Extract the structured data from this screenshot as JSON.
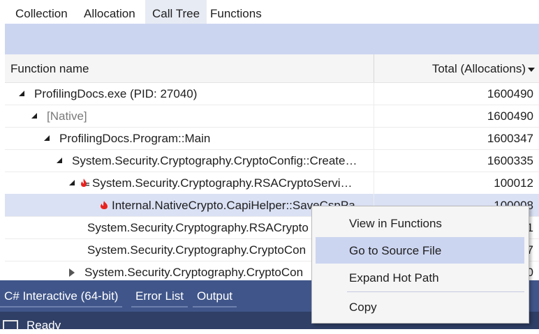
{
  "tabs": [
    "Collection",
    "Allocation",
    "Call Tree",
    "Functions"
  ],
  "active_tab": "Call Tree",
  "columns": {
    "name": "Function name",
    "total": "Total (Allocations)"
  },
  "rows": [
    {
      "label": "ProfilingDocs.exe (PID: 27040)",
      "value": "1600490",
      "expander": "expanded",
      "muted": false,
      "hot": false
    },
    {
      "label": "[Native]",
      "value": "1600490",
      "expander": "expanded",
      "muted": true,
      "hot": false
    },
    {
      "label": "ProfilingDocs.Program::Main",
      "value": "1600347",
      "expander": "expanded",
      "muted": false,
      "hot": false
    },
    {
      "label": "System.Security.Cryptography.CryptoConfig::Create…",
      "value": "1600335",
      "expander": "expanded",
      "muted": false,
      "hot": false
    },
    {
      "label": "System.Security.Cryptography.RSACryptoServi…",
      "value": "100012",
      "expander": "expanded",
      "muted": false,
      "hot": "flame-expand"
    },
    {
      "label": "Internal.NativeCrypto.CapiHelper::SaveCspPa…",
      "value": "100008",
      "expander": "none",
      "muted": false,
      "hot": "flame",
      "selected": true
    },
    {
      "label": "System.Security.Cryptography.RSACrypto",
      "value": "1",
      "expander": "none",
      "muted": false,
      "hot": false
    },
    {
      "label": "System.Security.Cryptography.CryptoCon",
      "value": "7",
      "expander": "none",
      "muted": false,
      "hot": false
    },
    {
      "label": "System.Security.Cryptography.CryptoCon",
      "value": "0",
      "expander": "collapsed",
      "muted": false,
      "hot": false
    }
  ],
  "bottom_tabs": [
    "C# Interactive (64-bit)",
    "Error List",
    "Output"
  ],
  "status": {
    "text": "Ready"
  },
  "context_menu": {
    "items": [
      "View in Functions",
      "Go to Source File",
      "Expand Hot Path",
      "Copy"
    ],
    "highlighted": "Go to Source File"
  },
  "colors": {
    "accent": "#ccd5f0",
    "bottom_bar": "#40568a",
    "status_bar": "#2f3f66",
    "selection": "#dae1f4",
    "flame": "#e8231f"
  }
}
